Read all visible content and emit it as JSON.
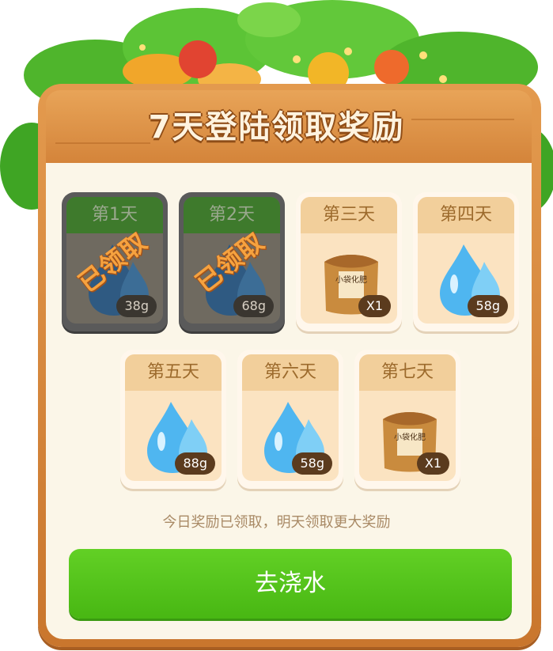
{
  "title": "7天登陆领取奖励",
  "stamp_text": "已领取",
  "days": [
    {
      "label": "第1天",
      "amount": "38g",
      "reward": "water",
      "claimed": true
    },
    {
      "label": "第2天",
      "amount": "68g",
      "reward": "water",
      "claimed": true
    },
    {
      "label": "第三天",
      "amount": "X1",
      "reward": "fertilizer",
      "claimed": false,
      "bag_text": "小袋化肥"
    },
    {
      "label": "第四天",
      "amount": "58g",
      "reward": "water",
      "claimed": false
    },
    {
      "label": "第五天",
      "amount": "88g",
      "reward": "water",
      "claimed": false
    },
    {
      "label": "第六天",
      "amount": "58g",
      "reward": "water",
      "claimed": false
    },
    {
      "label": "第七天",
      "amount": "X1",
      "reward": "fertilizer",
      "claimed": false,
      "bag_text": "小袋化肥"
    }
  ],
  "notice": "今日奖励已领取，明天领取更大奖励",
  "action_button": "去浇水",
  "colors": {
    "board": "#d4843a",
    "panel": "#fbf6e8",
    "button": "#52c11a",
    "claimed_header": "#3e7a2c"
  }
}
